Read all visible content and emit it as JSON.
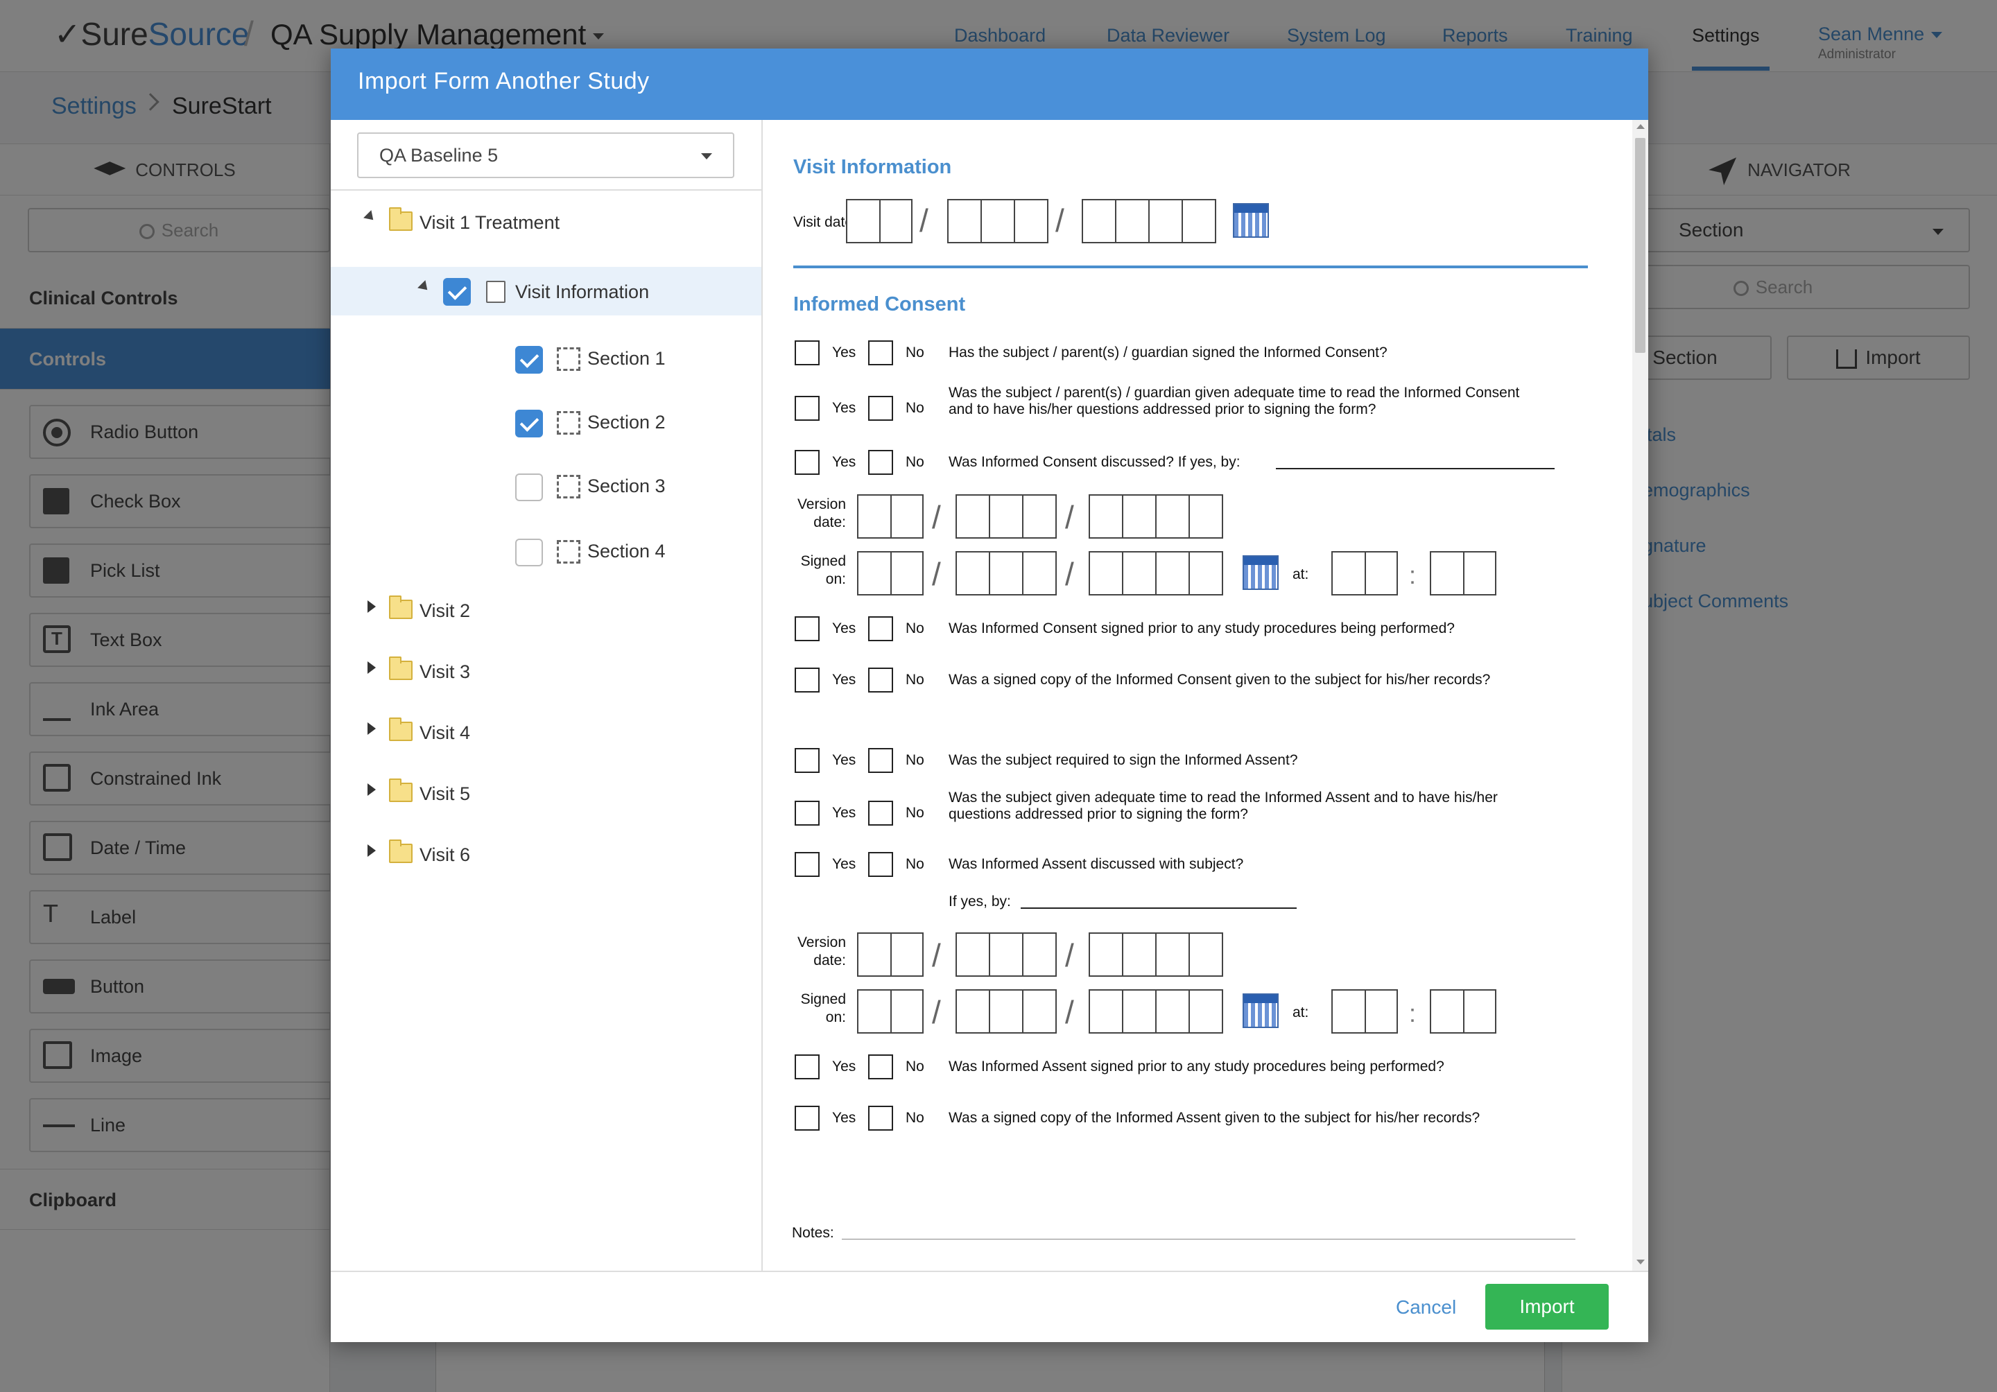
{
  "app": {
    "logo_part1": "✓Sure",
    "logo_part2": "Source",
    "separator": "/",
    "title": "QA Supply Management"
  },
  "nav": {
    "items": [
      "Dashboard",
      "Data Reviewer",
      "System Log",
      "Reports",
      "Training",
      "Settings"
    ],
    "active": "Settings",
    "user_name": "Sean Menne",
    "user_role": "Administrator"
  },
  "breadcrumb": {
    "root": "Settings",
    "current": "SureStart"
  },
  "left_panel": {
    "header": "CONTROLS",
    "search_placeholder": "Search",
    "categories": [
      "Clinical Controls",
      "Controls",
      "Clipboard"
    ],
    "controls": [
      "Radio Button",
      "Check Box",
      "Pick List",
      "Text Box",
      "Ink Area",
      "Constrained Ink",
      "Date / Time",
      "Label",
      "Button",
      "Image",
      "Line"
    ]
  },
  "right_panel": {
    "header": "NAVIGATOR",
    "dropdown": "Section",
    "search_placeholder": "Search",
    "section_button": "Section",
    "import_button": "Import",
    "links": [
      "itals",
      "emographics",
      "gnature",
      "ubject Comments"
    ]
  },
  "dialog": {
    "title": "Import Form Another Study",
    "study_select": "QA Baseline 5",
    "tree": {
      "root": "Visit 1 Treatment",
      "form": "Visit Information",
      "sections": [
        {
          "label": "Section 1",
          "checked": true
        },
        {
          "label": "Section 2",
          "checked": true
        },
        {
          "label": "Section 3",
          "checked": false
        },
        {
          "label": "Section 4",
          "checked": false
        }
      ],
      "visits": [
        "Visit 2",
        "Visit 3",
        "Visit 4",
        "Visit 5",
        "Visit 6"
      ]
    },
    "cancel": "Cancel",
    "import": "Import"
  },
  "form": {
    "visit_title": "Visit Information",
    "visit_date_label": "Visit date:",
    "consent_title": "Informed Consent",
    "yes": "Yes",
    "no": "No",
    "q1": "Has the subject / parent(s) / guardian signed the Informed Consent?",
    "q2a": "Was the subject / parent(s) / guardian given adequate time to read the Informed Consent",
    "q2b": "and to have his/her questions addressed prior to signing the form?",
    "q3": "Was Informed Consent discussed? If yes, by:",
    "version": "Version",
    "date": "date:",
    "signed": "Signed",
    "on": "on:",
    "at": "at:",
    "slash": "/",
    "colon": ":",
    "q4": "Was Informed Consent signed prior to any study procedures being performed?",
    "q5": "Was a signed copy of the Informed Consent given to the subject for his/her records?",
    "q6": "Was the subject required to sign the Informed Assent?",
    "q7a": "Was the subject given adequate time to read the Informed Assent and to have his/her",
    "q7b": "questions addressed prior to signing the form?",
    "q8": "Was Informed Assent discussed with subject?",
    "q8b": "If yes, by:",
    "q9": "Was Informed Assent signed prior to any study procedures being performed?",
    "q10": "Was a signed copy of the Informed Assent given to the subject for his/her records?",
    "notes": "Notes:"
  },
  "colors": {
    "accent": "#4a90d9",
    "import_green": "#34b555",
    "link": "#4a8fce"
  }
}
